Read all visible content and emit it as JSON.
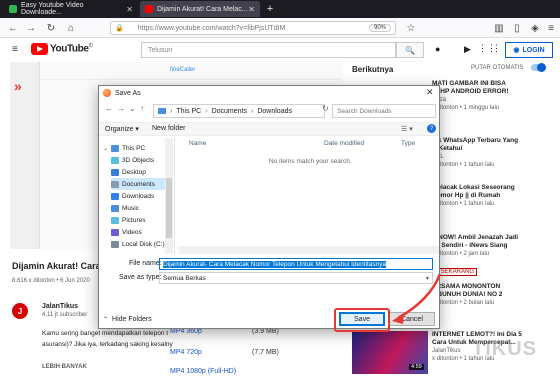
{
  "browser": {
    "tabs": [
      {
        "label": "Easy Youtube Video Downloade..."
      },
      {
        "label": "Dijamin Akurat! Cara Melac..."
      }
    ],
    "url": "https://www.youtube.com/watch?v=fibPjsUTdIM",
    "zoom": "90%"
  },
  "youtube": {
    "logo_text": "YouTube",
    "logo_suffix": "ID",
    "search_placeholder": "Telusuri",
    "login_label": "LOGIN",
    "video_title": "Dijamin Akurat! Cara M",
    "video_meta": "8.616 x ditonton • 6 Jun 2020",
    "channel_initial": "J",
    "channel_name": "JalanTikus",
    "channel_subs": "4,11 jt subscriber",
    "description_line1": "Kamu sering banget mendapatkan telepon t",
    "description_line2": "asuransi)? Jika iya, terkadang saking kesalny",
    "more_label": "LEBIH BANYAK",
    "mini_label": "fineCaller"
  },
  "download_list": [
    {
      "label": "MP4 360p",
      "size": "(3.9 MB)"
    },
    {
      "label": "MP4 720p",
      "size": "(7.7 MB)"
    },
    {
      "label": "MP4 1080p (Full-HD)",
      "size": ""
    }
  ],
  "sidebar": {
    "next_title": "Berikutnya",
    "autoplay_label": "PUTAR OTOMATIS",
    "recommendations": [
      {
        "title": "MATI GAMBAR INI BISA",
        "title2": "IN HP ANDROID ERROR!",
        "channel": "Reza",
        "meta": "x ditonton • 1 minggu lalu"
      },
      {
        "title": "nik WhatsApp Terbaru Yang",
        "title2": "DiKetahui",
        "channel": "MaL",
        "meta": "x ditonton • 1 tahun lalu"
      },
      {
        "title": "Melacak Lokasi Seseorang",
        "title2": "Nomor Hp || di Rumah",
        "channel": "",
        "meta": "x ditonton • 1 tahun lalu"
      },
      {
        "title": "E NOW! Ambil Jenazah Jadi",
        "title2": "ga Sendiri - iNews Siang",
        "channel": "",
        "meta": "x ditonton • 2 jam lalu"
      },
      {
        "title": "ERSAMA MONONTON",
        "title2": "MBUNUH DUNIA! NO 2",
        "channel": "",
        "meta": "x ditonton • 2 bulan lalu"
      },
      {
        "title": "INTERNET LEMOT?! Ini Dia 5",
        "title2": "Cara Untuk Mempercepat...",
        "channel": "JalanTikus",
        "meta": "x ditonton • 1 tahun lalu"
      }
    ],
    "badge": "E SEKARANG",
    "thumb_time": "4:59",
    "watermark": "TIKUS"
  },
  "dialog": {
    "title": "Save As",
    "path": [
      "This PC",
      "Documents",
      "Downloads"
    ],
    "search_placeholder": "Search Downloads",
    "organize_label": "Organize",
    "new_folder_label": "New folder",
    "nav_items": [
      {
        "label": "This PC",
        "color": "#4a90d9"
      },
      {
        "label": "3D Objects",
        "color": "#5bc0de"
      },
      {
        "label": "Desktop",
        "color": "#3a7bd5"
      },
      {
        "label": "Documents",
        "color": "#8a9bb0"
      },
      {
        "label": "Downloads",
        "color": "#2f80ed"
      },
      {
        "label": "Music",
        "color": "#4a90d9"
      },
      {
        "label": "Pictures",
        "color": "#5bc0de"
      },
      {
        "label": "Videos",
        "color": "#6d5bd0"
      },
      {
        "label": "Local Disk (C:)",
        "color": "#7a8a99"
      }
    ],
    "columns": [
      "Name",
      "Date modified",
      "Type"
    ],
    "empty_message": "No items match your search.",
    "file_name_label": "File name:",
    "file_name_value": "Dijamin Akurat- Cara Melacak Nomor Telepon Untuk Mengetahui Identitasnya",
    "save_type_label": "Save as type:",
    "save_type_value": "Semua Berkas",
    "hide_folders_label": "Hide Folders",
    "save_label": "Save",
    "cancel_label": "Cancel"
  },
  "colors": {
    "annotation_red": "#e53935",
    "youtube_red": "#ff0000",
    "link_blue": "#065fd4"
  }
}
